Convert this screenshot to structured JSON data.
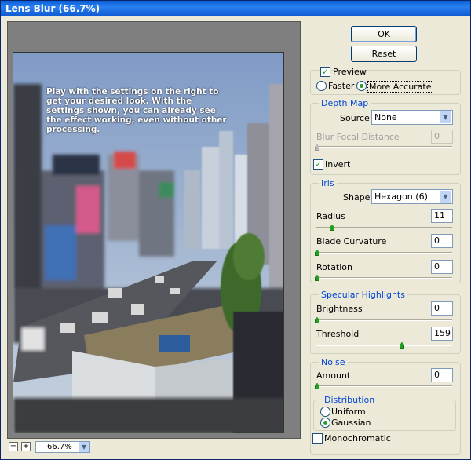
{
  "window": {
    "title": "Lens Blur (66.7%)"
  },
  "preview": {
    "caption": "Play with the settings on the right to get your desired look. With the settings shown, you can already see the effect working, even without other processing."
  },
  "zoom": {
    "minus": "−",
    "plus": "+",
    "value": "66.7%"
  },
  "buttons": {
    "ok": "OK",
    "reset": "Reset"
  },
  "preview_options": {
    "preview_label": "Preview",
    "preview_checked": true,
    "faster_label": "Faster",
    "more_accurate_label": "More Accurate",
    "selected": "More Accurate"
  },
  "depth_map": {
    "title": "Depth Map",
    "source_label": "Source:",
    "source_value": "None",
    "focal_label": "Blur Focal Distance",
    "focal_value": "0",
    "invert_label": "Invert",
    "invert_checked": true
  },
  "iris": {
    "title": "Iris",
    "shape_label": "Shape:",
    "shape_value": "Hexagon (6)",
    "radius_label": "Radius",
    "radius_value": "11",
    "blade_label": "Blade Curvature",
    "blade_value": "0",
    "rotation_label": "Rotation",
    "rotation_value": "0"
  },
  "specular": {
    "title": "Specular Highlights",
    "brightness_label": "Brightness",
    "brightness_value": "0",
    "threshold_label": "Threshold",
    "threshold_value": "159"
  },
  "noise": {
    "title": "Noise",
    "amount_label": "Amount",
    "amount_value": "0",
    "distribution_title": "Distribution",
    "uniform_label": "Uniform",
    "gaussian_label": "Gaussian",
    "selected": "Gaussian",
    "mono_label": "Monochromatic",
    "mono_checked": false
  },
  "colors": {
    "accent": "#0046d5",
    "check": "#21a121",
    "titlebar": "#0a5fd8"
  },
  "icons": {
    "check": "✓",
    "arrow": "▼"
  }
}
